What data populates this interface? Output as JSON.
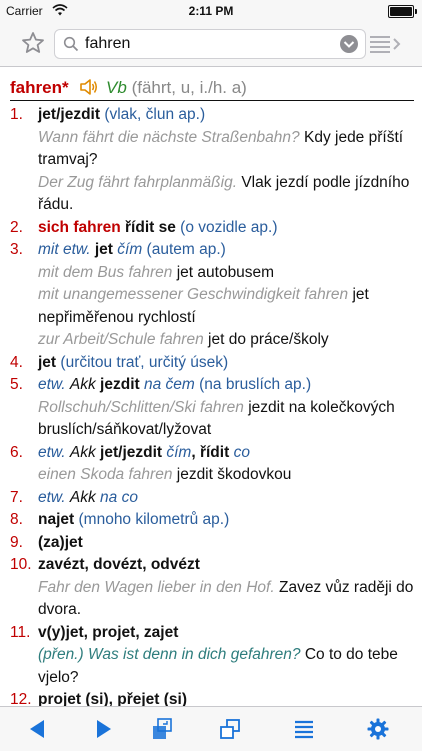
{
  "status_bar": {
    "carrier": "Carrier",
    "time": "2:11 PM"
  },
  "search": {
    "value": "fahren",
    "placeholder": ""
  },
  "headword": {
    "word": "fahren*",
    "pos": "Vb",
    "forms": "(fährt, u, i./h. a)"
  },
  "senses": [
    {
      "num": "1.",
      "main": "jet/jezdit",
      "gloss": "(vlak, člun ap.)",
      "ex1_de": "Wann fährt die nächste Straßenbahn?",
      "ex1_cz": "Kdy jede příští tramvaj?",
      "ex2_de": "Der Zug fährt fahrplanmäßig.",
      "ex2_cz": "Vlak jezdí podle jízdního řádu."
    },
    {
      "num": "2.",
      "main": "sich fahren",
      "main2": "řídit se",
      "gloss": "(o vozidle ap.)"
    },
    {
      "num": "3.",
      "pre": "mit etw.",
      "main": "jet",
      "mid": "čím",
      "gloss": "(autem ap.)",
      "ex1_de": "mit dem Bus fahren",
      "ex1_cz": "jet autobusem",
      "ex2_de": "mit unangemessener Geschwindigkeit fahren",
      "ex2_cz": "jet nepřiměřenou rychlostí",
      "ex3_de": "zur Arbeit/Schule fahren",
      "ex3_cz": "jet do práce/školy"
    },
    {
      "num": "4.",
      "main": "jet",
      "gloss": "(určitou trať, určitý úsek)"
    },
    {
      "num": "5.",
      "pre": "etw.",
      "pre2": "Akk",
      "main": "jezdit",
      "mid": "na čem",
      "gloss": "(na bruslích ap.)",
      "ex1_de": "Rollschuh/Schlitten/Ski fahren",
      "ex1_cz": "jezdit na kolečkových bruslích/sáňkovat/lyžovat"
    },
    {
      "num": "6.",
      "pre": "etw.",
      "pre2": "Akk",
      "main": "jet/jezdit",
      "mid": "čím",
      "main2": "řídit",
      "mid2": "co",
      "ex1_de": "einen Skoda fahren",
      "ex1_cz": "jezdit škodovkou"
    },
    {
      "num": "7.",
      "pre": "etw.",
      "pre2": "Akk",
      "mid": "na co"
    },
    {
      "num": "8.",
      "main": "najet",
      "gloss": "(mnoho kilometrů ap.)"
    },
    {
      "num": "9.",
      "main": "(za)jet"
    },
    {
      "num": "10.",
      "main": "zavézt, dovézt, odvézt",
      "ex1_de": "Fahr den Wagen lieber in den Hof.",
      "ex1_cz": "Zavez vůz raději do dvora."
    },
    {
      "num": "11.",
      "main": "v(y)jet, projet, zajet",
      "pre": "(přen.)",
      "ex1_de": "Was ist denn in dich gefahren?",
      "ex1_cz": "Co to do tebe vjelo?"
    },
    {
      "num": "12.",
      "main": "projet (si), přejet (si)"
    }
  ],
  "colors": {
    "headword": "#c00000",
    "pos": "#2e8b2e",
    "gloss": "#2a5d9c",
    "example": "#999999",
    "accent": "#1a73d9"
  },
  "icons": {
    "favorite": "star-icon",
    "search": "search-icon",
    "history": "chevron-down-icon",
    "list": "list-arrow-icon",
    "back": "arrow-left-icon",
    "forward": "arrow-right-icon",
    "copy": "copy-window-icon",
    "windows": "windows-icon",
    "lines": "list-lines-icon",
    "settings": "gear-icon"
  }
}
